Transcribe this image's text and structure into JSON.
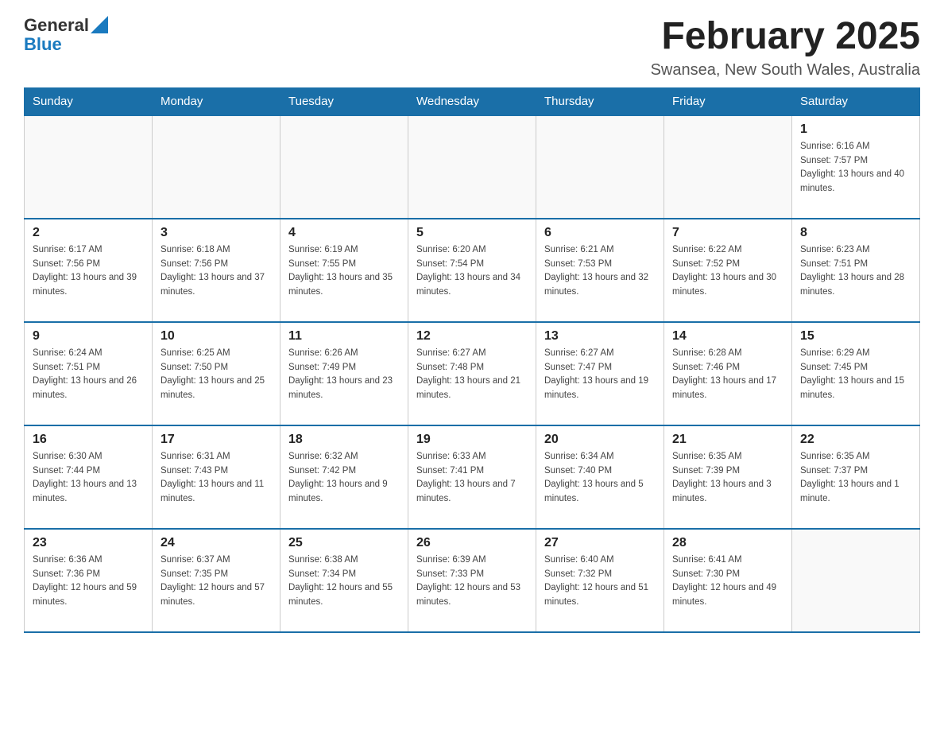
{
  "logo": {
    "general": "General",
    "blue": "Blue",
    "arrow": "▲"
  },
  "header": {
    "title": "February 2025",
    "location": "Swansea, New South Wales, Australia"
  },
  "weekdays": [
    "Sunday",
    "Monday",
    "Tuesday",
    "Wednesday",
    "Thursday",
    "Friday",
    "Saturday"
  ],
  "weeks": [
    [
      {
        "day": "",
        "info": ""
      },
      {
        "day": "",
        "info": ""
      },
      {
        "day": "",
        "info": ""
      },
      {
        "day": "",
        "info": ""
      },
      {
        "day": "",
        "info": ""
      },
      {
        "day": "",
        "info": ""
      },
      {
        "day": "1",
        "info": "Sunrise: 6:16 AM\nSunset: 7:57 PM\nDaylight: 13 hours and 40 minutes."
      }
    ],
    [
      {
        "day": "2",
        "info": "Sunrise: 6:17 AM\nSunset: 7:56 PM\nDaylight: 13 hours and 39 minutes."
      },
      {
        "day": "3",
        "info": "Sunrise: 6:18 AM\nSunset: 7:56 PM\nDaylight: 13 hours and 37 minutes."
      },
      {
        "day": "4",
        "info": "Sunrise: 6:19 AM\nSunset: 7:55 PM\nDaylight: 13 hours and 35 minutes."
      },
      {
        "day": "5",
        "info": "Sunrise: 6:20 AM\nSunset: 7:54 PM\nDaylight: 13 hours and 34 minutes."
      },
      {
        "day": "6",
        "info": "Sunrise: 6:21 AM\nSunset: 7:53 PM\nDaylight: 13 hours and 32 minutes."
      },
      {
        "day": "7",
        "info": "Sunrise: 6:22 AM\nSunset: 7:52 PM\nDaylight: 13 hours and 30 minutes."
      },
      {
        "day": "8",
        "info": "Sunrise: 6:23 AM\nSunset: 7:51 PM\nDaylight: 13 hours and 28 minutes."
      }
    ],
    [
      {
        "day": "9",
        "info": "Sunrise: 6:24 AM\nSunset: 7:51 PM\nDaylight: 13 hours and 26 minutes."
      },
      {
        "day": "10",
        "info": "Sunrise: 6:25 AM\nSunset: 7:50 PM\nDaylight: 13 hours and 25 minutes."
      },
      {
        "day": "11",
        "info": "Sunrise: 6:26 AM\nSunset: 7:49 PM\nDaylight: 13 hours and 23 minutes."
      },
      {
        "day": "12",
        "info": "Sunrise: 6:27 AM\nSunset: 7:48 PM\nDaylight: 13 hours and 21 minutes."
      },
      {
        "day": "13",
        "info": "Sunrise: 6:27 AM\nSunset: 7:47 PM\nDaylight: 13 hours and 19 minutes."
      },
      {
        "day": "14",
        "info": "Sunrise: 6:28 AM\nSunset: 7:46 PM\nDaylight: 13 hours and 17 minutes."
      },
      {
        "day": "15",
        "info": "Sunrise: 6:29 AM\nSunset: 7:45 PM\nDaylight: 13 hours and 15 minutes."
      }
    ],
    [
      {
        "day": "16",
        "info": "Sunrise: 6:30 AM\nSunset: 7:44 PM\nDaylight: 13 hours and 13 minutes."
      },
      {
        "day": "17",
        "info": "Sunrise: 6:31 AM\nSunset: 7:43 PM\nDaylight: 13 hours and 11 minutes."
      },
      {
        "day": "18",
        "info": "Sunrise: 6:32 AM\nSunset: 7:42 PM\nDaylight: 13 hours and 9 minutes."
      },
      {
        "day": "19",
        "info": "Sunrise: 6:33 AM\nSunset: 7:41 PM\nDaylight: 13 hours and 7 minutes."
      },
      {
        "day": "20",
        "info": "Sunrise: 6:34 AM\nSunset: 7:40 PM\nDaylight: 13 hours and 5 minutes."
      },
      {
        "day": "21",
        "info": "Sunrise: 6:35 AM\nSunset: 7:39 PM\nDaylight: 13 hours and 3 minutes."
      },
      {
        "day": "22",
        "info": "Sunrise: 6:35 AM\nSunset: 7:37 PM\nDaylight: 13 hours and 1 minute."
      }
    ],
    [
      {
        "day": "23",
        "info": "Sunrise: 6:36 AM\nSunset: 7:36 PM\nDaylight: 12 hours and 59 minutes."
      },
      {
        "day": "24",
        "info": "Sunrise: 6:37 AM\nSunset: 7:35 PM\nDaylight: 12 hours and 57 minutes."
      },
      {
        "day": "25",
        "info": "Sunrise: 6:38 AM\nSunset: 7:34 PM\nDaylight: 12 hours and 55 minutes."
      },
      {
        "day": "26",
        "info": "Sunrise: 6:39 AM\nSunset: 7:33 PM\nDaylight: 12 hours and 53 minutes."
      },
      {
        "day": "27",
        "info": "Sunrise: 6:40 AM\nSunset: 7:32 PM\nDaylight: 12 hours and 51 minutes."
      },
      {
        "day": "28",
        "info": "Sunrise: 6:41 AM\nSunset: 7:30 PM\nDaylight: 12 hours and 49 minutes."
      },
      {
        "day": "",
        "info": ""
      }
    ]
  ]
}
